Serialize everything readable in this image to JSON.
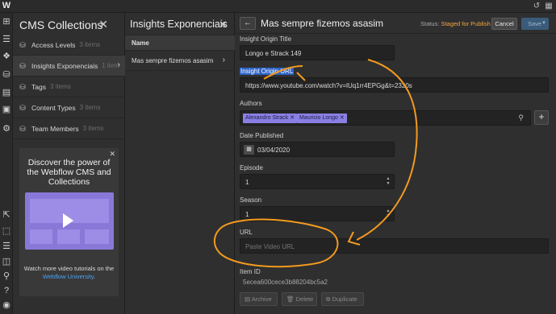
{
  "colors": {
    "accent_blue": "#4aa3f1",
    "status_orange": "#f3a53d",
    "tag_purple": "#8a7fe3",
    "annotation_orange": "#f29a1f"
  },
  "collections": {
    "title": "CMS Collections",
    "items": [
      {
        "name": "Access Levels",
        "count": "3 items",
        "icon": "database-icon"
      },
      {
        "name": "Insights Exponenciais",
        "count": "1 item",
        "icon": "database-icon"
      },
      {
        "name": "Tags",
        "count": "3 items",
        "icon": "database-icon"
      },
      {
        "name": "Content Types",
        "count": "3 items",
        "icon": "database-icon"
      },
      {
        "name": "Team Members",
        "count": "3 items",
        "icon": "database-icon"
      }
    ],
    "promo": {
      "title": "Discover the power of the Webflow CMS and Collections",
      "text_before": "Watch more video tutorials on the",
      "link": "Webflow University",
      "text_after": "."
    }
  },
  "items_panel": {
    "title": "Insights Exponenciais",
    "column": "Name",
    "rows": [
      "Mas sempre fizemos asasim"
    ]
  },
  "editor": {
    "title": "Mas sempre fizemos asasim",
    "status_label": "Status:",
    "status_value": "Staged for Publish",
    "cancel": "Cancel",
    "save": "Save",
    "fields": {
      "origin_title_label": "Insight Origin Title",
      "origin_title_value": "Longo e Strack 149",
      "origin_url_label": "Insight Origin URL",
      "origin_url_value": "https://www.youtube.com/watch?v=lUq1rr4EPGg&t=2320s",
      "authors_label": "Authors",
      "authors": [
        "Alexandro Strack",
        "Mauricio Longo"
      ],
      "date_label": "Date Published",
      "date_value": "03/04/2020",
      "episode_label": "Episode",
      "episode_value": "1",
      "season_label": "Season",
      "season_value": "1",
      "url_label": "URL",
      "url_placeholder": "Paste Video URL",
      "item_id_label": "Item ID",
      "item_id_value": "5ecea600cece3b88204bc5a2"
    },
    "footer": {
      "archive": "Archive",
      "delete": "Delete",
      "duplicate": "Duplicate"
    }
  }
}
